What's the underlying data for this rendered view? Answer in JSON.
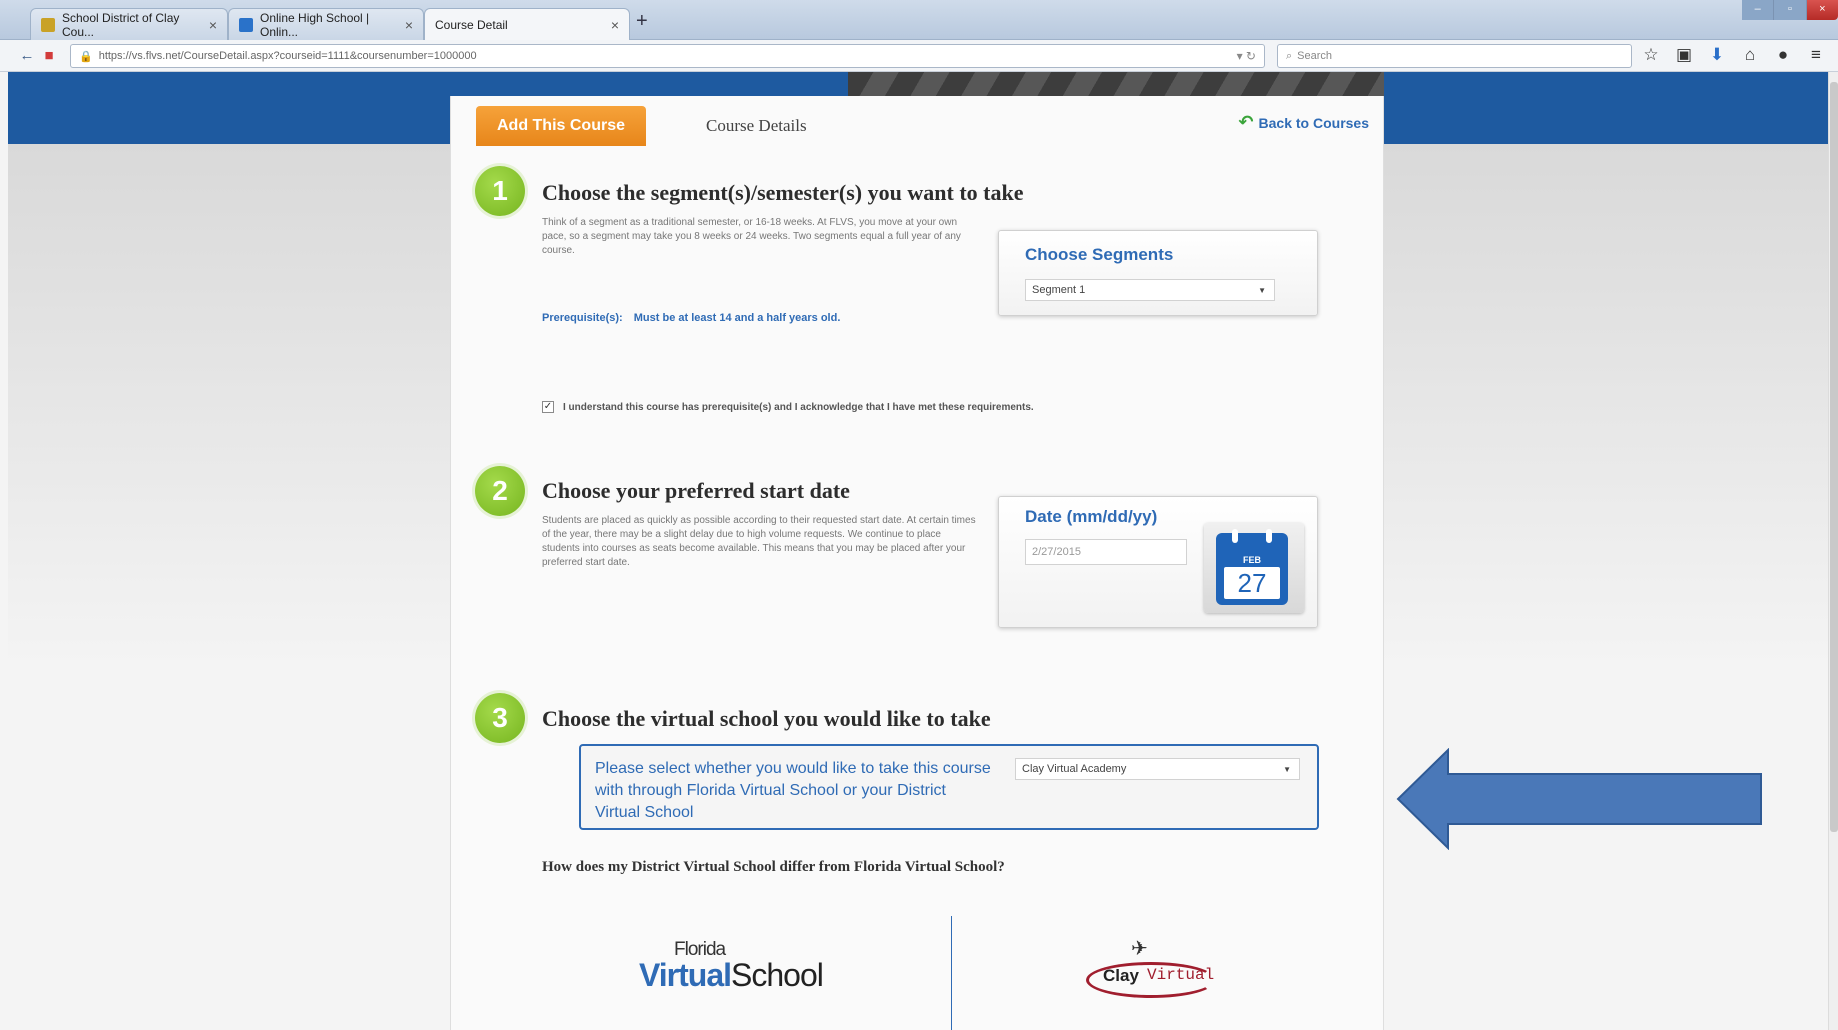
{
  "browser": {
    "tabs": [
      {
        "label": "School District of Clay Cou...",
        "favicon_color": "#c9a227"
      },
      {
        "label": "Online High School | Onlin...",
        "favicon_color": "#2a72c9"
      },
      {
        "label": "Course Detail",
        "favicon_color": ""
      }
    ],
    "url": "https://vs.flvs.net/CourseDetail.aspx?courseid=1111&coursenumber=1000000",
    "search_placeholder": "Search",
    "toolbar_icons": [
      "star-icon",
      "clipboard-icon",
      "download-icon",
      "home-icon",
      "chat-icon",
      "menu-icon"
    ]
  },
  "course_tabs": {
    "add_label": "Add This Course",
    "details_label": "Course Details",
    "back_label": "Back to Courses"
  },
  "step1": {
    "number": "1",
    "title": "Choose the segment(s)/semester(s) you want to take",
    "description": "Think of a segment as a traditional semester, or 16-18 weeks. At FLVS, you move at your own pace, so a segment may take you 8 weeks or 24 weeks. Two segments equal a full year of any course.",
    "prereq_label": "Prerequisite(s):",
    "prereq_text": "Must be at least 14 and a half years old.",
    "segments_title": "Choose Segments",
    "segment_selected": "Segment 1",
    "ack_text": "I understand this course has prerequisite(s) and I acknowledge that I have met these requirements.",
    "ack_checked": true
  },
  "step2": {
    "number": "2",
    "title": "Choose your preferred start date",
    "description": "Students are placed as quickly as possible according to their requested start date. At certain times of the year, there may be a slight delay due to high volume requests. We continue to place students into courses as seats become available. This means that you may be placed after your preferred start date.",
    "date_title": "Date (mm/dd/yy)",
    "date_value": "2/27/2015",
    "calendar_month": "FEB",
    "calendar_day": "27"
  },
  "step3": {
    "number": "3",
    "title": "Choose the virtual school you would like to take",
    "prompt": "Please select whether you would like to take this course with through Florida Virtual School or your District Virtual School",
    "school_selected": "Clay Virtual Academy",
    "differ_question": "How does my District Virtual School differ from Florida Virtual School?"
  },
  "logos": {
    "flvs_line1": "Florida",
    "flvs_bold": "Virtual",
    "flvs_rest": "School",
    "clay_word": "Clay",
    "clay_virtual": "Virtual"
  },
  "colors": {
    "brand_blue": "#1e5aa0",
    "accent_orange": "#f39a2e",
    "step_green": "#8cc63f",
    "link_blue": "#2f6bb5",
    "arrow_blue": "#4a78b8"
  }
}
